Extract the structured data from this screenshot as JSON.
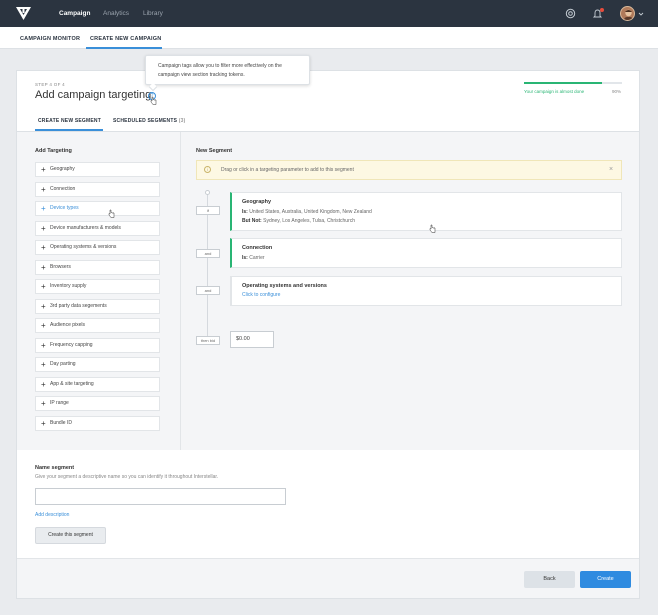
{
  "topnav": {
    "items": [
      "Campaign",
      "Analytics",
      "Library"
    ],
    "accent": "#2b3440"
  },
  "subnav": {
    "tabs": [
      "CAMPAIGN MONITOR",
      "CREATE NEW CAMPAIGN"
    ]
  },
  "header": {
    "step": "STEP 4 OF 4",
    "title": "Add campaign targeting",
    "help_glyph": "?",
    "tooltip": "Campaign tags allow you to filter more effectively on the campaign view section tracking tokens.",
    "progress_text": "Your campaign is almost done",
    "progress_value": "90%",
    "progress_fraction": 0.9,
    "progress_color": "#29b574"
  },
  "tabs": {
    "create": "CREATE NEW SEGMENT",
    "scheduled": "SCHEDULED SEGMENTS",
    "scheduled_count": "(3)"
  },
  "targeting": {
    "heading": "Add Targeting",
    "items": [
      "Geography",
      "Connection",
      "Device types",
      "Device manufacturers & models",
      "Operating systems & versions",
      "Browsers",
      "Inventory supply",
      "3rd party data segements",
      "Audience pixels",
      "Frequency capping",
      "Day parting",
      "App & site targeting",
      "IP range",
      "Bundle ID"
    ],
    "active_index": 2
  },
  "segment": {
    "heading": "New Segment",
    "banner": "Drag or click in a targeting parameter to add to this segment",
    "connectors": [
      "if",
      "and",
      "and",
      "then bid"
    ],
    "cards": [
      {
        "title": "Geography",
        "is_label": "Is:",
        "is_value": "United States, Australia, United Kingdom, New Zealand",
        "but_label": "But Not:",
        "but_value": "Sydney, Los Angeles, Tulsa, Christchurch"
      },
      {
        "title": "Connection",
        "is_label": "Is:",
        "is_value": "Carrier"
      },
      {
        "title": "Operating systems and versions",
        "link": "Click to configure"
      }
    ],
    "bid_value": "$0.00"
  },
  "name_segment": {
    "label": "Name segment",
    "help": "Give your segment a descriptive name so you can identify it throughout Interstellar.",
    "add_description": "Add description",
    "button": "Create this segment"
  },
  "footer": {
    "back": "Back",
    "create": "Create",
    "create_color": "#2f8be0"
  }
}
